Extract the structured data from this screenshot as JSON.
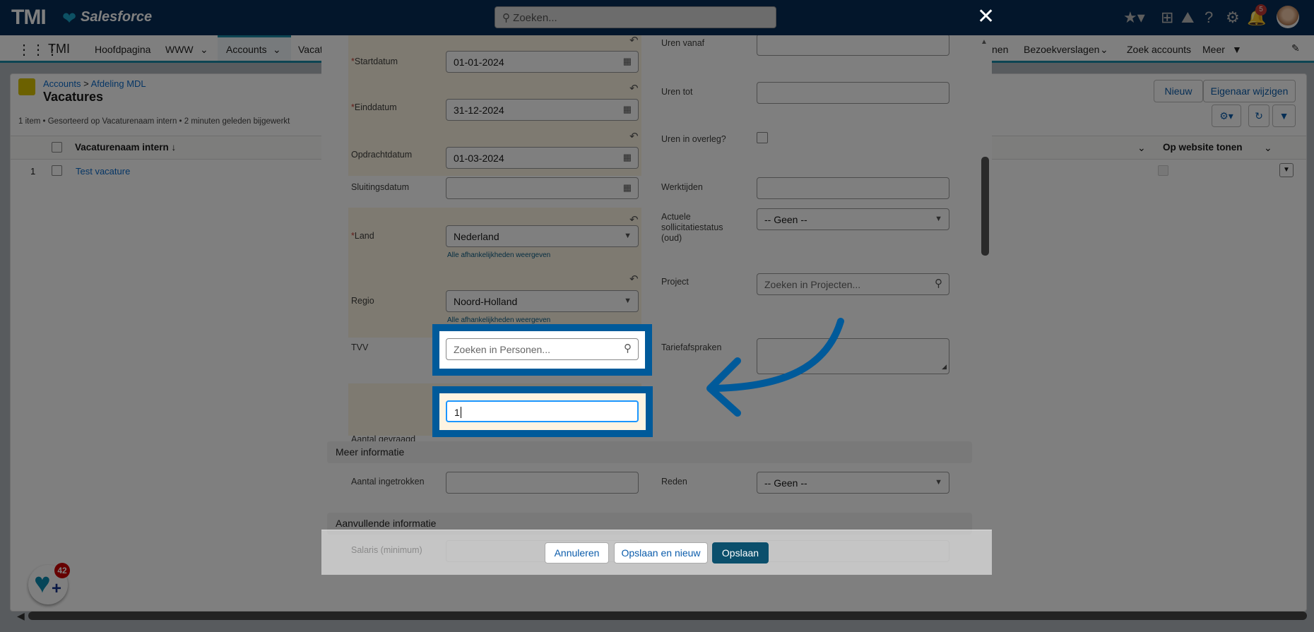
{
  "header": {
    "logo": "TMI",
    "brand": "Salesforce",
    "search_placeholder": "Zoeken...",
    "close": "✕",
    "notifications": "5"
  },
  "nav": {
    "app": "TMI",
    "items": [
      "Hoofdpagina",
      "WWW",
      "Accounts",
      "Vacat",
      "nen",
      "Bezoekverslagen",
      "Zoek accounts",
      "Meer"
    ]
  },
  "list": {
    "breadcrumb_1": "Accounts",
    "breadcrumb_sep": ">",
    "breadcrumb_2": "Afdeling MDL",
    "title": "Vacatures",
    "meta": "1 item • Gesorteerd op Vacaturenaam intern • 2 minuten geleden bijgewerkt",
    "new": "Nieuw",
    "change_owner": "Eigenaar wijzigen",
    "col_name": "Vacaturenaam intern ↓",
    "col_web": "Op website tonen",
    "rows": [
      {
        "num": "1",
        "name": "Test vacature"
      }
    ]
  },
  "form": {
    "startdatum": {
      "label": "Startdatum",
      "value": "01-01-2024"
    },
    "einddatum": {
      "label": "Einddatum",
      "value": "31-12-2024"
    },
    "opdrachtdatum": {
      "label": "Opdrachtdatum",
      "value": "01-03-2024"
    },
    "sluitingsdatum": {
      "label": "Sluitingsdatum",
      "value": ""
    },
    "land": {
      "label": "Land",
      "value": "Nederland",
      "dep": "Alle afhankelijkheden weergeven"
    },
    "regio": {
      "label": "Regio",
      "value": "Noord-Holland",
      "dep": "Alle afhankelijkheden weergeven"
    },
    "tvv": {
      "label": "TVV",
      "placeholder": "Zoeken in Personen..."
    },
    "aantal_gevraagd": {
      "label": "Aantal gevraagd",
      "value": "1"
    },
    "uren_vanaf": {
      "label": "Uren vanaf"
    },
    "uren_tot": {
      "label": "Uren tot"
    },
    "uren_overleg": {
      "label": "Uren in overleg?",
      "checked": false
    },
    "werktijden": {
      "label": "Werktijden"
    },
    "status": {
      "label": "Actuele sollicitatiestatus (oud)",
      "value": "-- Geen --"
    },
    "project": {
      "label": "Project",
      "placeholder": "Zoeken in Projecten..."
    },
    "tarief": {
      "label": "Tariefafspraken"
    },
    "section_meer": "Meer informatie",
    "aantal_ingetrokken": {
      "label": "Aantal ingetrokken"
    },
    "reden": {
      "label": "Reden",
      "value": "-- Geen --"
    },
    "section_aanvullend": "Aanvullende informatie",
    "salaris": {
      "label": "Salaris (minimum)"
    }
  },
  "footer": {
    "cancel": "Annuleren",
    "save_new": "Opslaan en nieuw",
    "save": "Opslaan"
  },
  "fab_badge": "42",
  "colors": {
    "highlight": "#005a9a",
    "save_button": "#0b4f6c",
    "header": "#062c56"
  }
}
